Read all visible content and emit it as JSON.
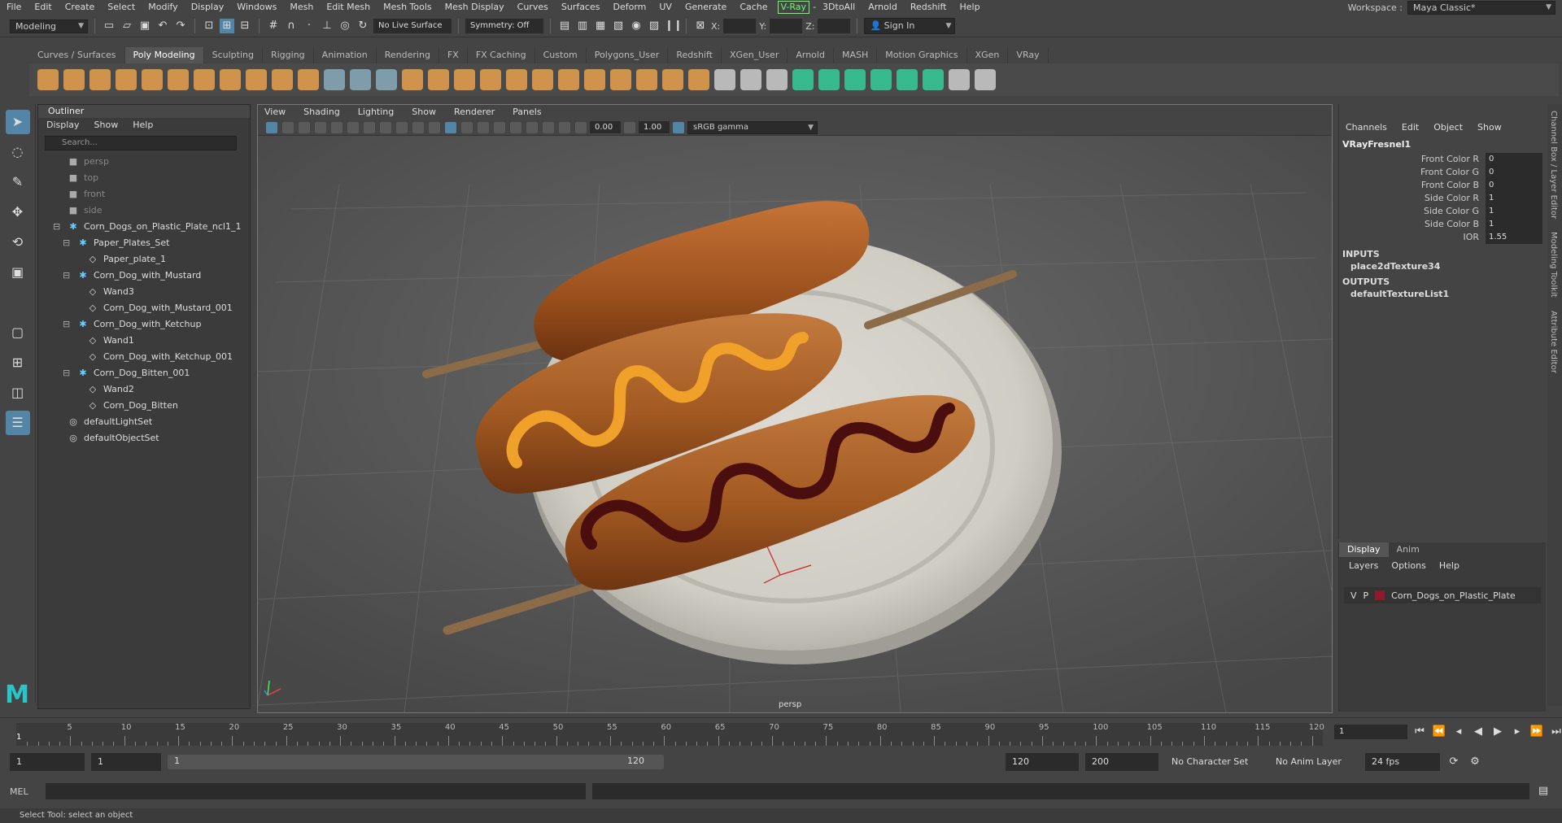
{
  "menubar": {
    "items": [
      "File",
      "Edit",
      "Create",
      "Select",
      "Modify",
      "Display",
      "Windows",
      "Mesh",
      "Edit Mesh",
      "Mesh Tools",
      "Mesh Display",
      "Curves",
      "Surfaces",
      "Deform",
      "UV",
      "Generate",
      "Cache"
    ],
    "vray": "V-Ray",
    "items2": [
      "3DtoAll",
      "Arnold",
      "Redshift",
      "Help"
    ],
    "workspace_label": "Workspace :",
    "workspace_value": "Maya Classic*"
  },
  "statusline": {
    "mode": "Modeling",
    "live_surface": "No Live Surface",
    "symmetry": "Symmetry: Off",
    "x_label": "X:",
    "y_label": "Y:",
    "z_label": "Z:",
    "sign_in": "Sign In"
  },
  "shelf": {
    "tabs": [
      "Curves / Surfaces",
      "Poly Modeling",
      "Sculpting",
      "Rigging",
      "Animation",
      "Rendering",
      "FX",
      "FX Caching",
      "Custom",
      "Polygons_User",
      "Redshift",
      "XGen_User",
      "Arnold",
      "MASH",
      "Motion Graphics",
      "XGen",
      "VRay"
    ],
    "active_tab": "Poly Modeling"
  },
  "outliner": {
    "title": "Outliner",
    "menu": [
      "Display",
      "Show",
      "Help"
    ],
    "search_placeholder": "Search...",
    "nodes": [
      {
        "label": "persp",
        "indent": 0,
        "kind": "cam"
      },
      {
        "label": "top",
        "indent": 0,
        "kind": "cam"
      },
      {
        "label": "front",
        "indent": 0,
        "kind": "cam"
      },
      {
        "label": "side",
        "indent": 0,
        "kind": "cam"
      },
      {
        "label": "Corn_Dogs_on_Plastic_Plate_ncl1_1",
        "indent": 0,
        "kind": "group"
      },
      {
        "label": "Paper_Plates_Set",
        "indent": 1,
        "kind": "group"
      },
      {
        "label": "Paper_plate_1",
        "indent": 2,
        "kind": "mesh"
      },
      {
        "label": "Corn_Dog_with_Mustard",
        "indent": 1,
        "kind": "group"
      },
      {
        "label": "Wand3",
        "indent": 2,
        "kind": "mesh"
      },
      {
        "label": "Corn_Dog_with_Mustard_001",
        "indent": 2,
        "kind": "mesh"
      },
      {
        "label": "Corn_Dog_with_Ketchup",
        "indent": 1,
        "kind": "group"
      },
      {
        "label": "Wand1",
        "indent": 2,
        "kind": "mesh"
      },
      {
        "label": "Corn_Dog_with_Ketchup_001",
        "indent": 2,
        "kind": "mesh"
      },
      {
        "label": "Corn_Dog_Bitten_001",
        "indent": 1,
        "kind": "group"
      },
      {
        "label": "Wand2",
        "indent": 2,
        "kind": "mesh"
      },
      {
        "label": "Corn_Dog_Bitten",
        "indent": 2,
        "kind": "mesh"
      },
      {
        "label": "defaultLightSet",
        "indent": 0,
        "kind": "set"
      },
      {
        "label": "defaultObjectSet",
        "indent": 0,
        "kind": "set"
      }
    ]
  },
  "viewport": {
    "menu": [
      "View",
      "Shading",
      "Lighting",
      "Show",
      "Renderer",
      "Panels"
    ],
    "field1": "0.00",
    "field2": "1.00",
    "colorspace": "sRGB gamma",
    "camera_label": "persp"
  },
  "channelbox": {
    "menu": [
      "Channels",
      "Edit",
      "Object",
      "Show"
    ],
    "object": "VRayFresnel1",
    "attributes": [
      {
        "name": "Front Color R",
        "value": "0"
      },
      {
        "name": "Front Color G",
        "value": "0"
      },
      {
        "name": "Front Color B",
        "value": "0"
      },
      {
        "name": "Side Color R",
        "value": "1"
      },
      {
        "name": "Side Color G",
        "value": "1"
      },
      {
        "name": "Side Color B",
        "value": "1"
      },
      {
        "name": "IOR",
        "value": "1.55"
      }
    ],
    "inputs_label": "INPUTS",
    "inputs_node": "place2dTexture34",
    "outputs_label": "OUTPUTS",
    "outputs_node": "defaultTextureList1"
  },
  "layereditor": {
    "tabs": [
      "Display",
      "Anim"
    ],
    "menu": [
      "Layers",
      "Options",
      "Help"
    ],
    "layer_v": "V",
    "layer_p": "P",
    "layer_name": "Corn_Dogs_on_Plastic_Plate",
    "layer_color": "#8b1a2f"
  },
  "sidetabs": [
    "Channel Box / Layer Editor",
    "Modeling Toolkit",
    "Attribute Editor"
  ],
  "timeline": {
    "labels": [
      "5",
      "10",
      "15",
      "20",
      "25",
      "30",
      "35",
      "40",
      "45",
      "50",
      "55",
      "60",
      "65",
      "70",
      "75",
      "80",
      "85",
      "90",
      "95",
      "100",
      "105",
      "110",
      "115",
      "120"
    ],
    "start_marker": "1",
    "current_frame": "1"
  },
  "range": {
    "start": "1",
    "playback_start": "1",
    "slider_start": "1",
    "slider_end": "120",
    "playback_end": "120",
    "end": "200",
    "character_set": "No Character Set",
    "anim_layer": "No Anim Layer",
    "fps": "24 fps"
  },
  "cmdline": {
    "label": "MEL"
  },
  "helpline": "Select Tool: select an object",
  "colors": {
    "accent": "#5285a6",
    "maya_logo": "#2ac5c9",
    "mustard": "#f0a12a",
    "ketchup": "#4a0e0e",
    "corn_dog": "#b8642a"
  }
}
